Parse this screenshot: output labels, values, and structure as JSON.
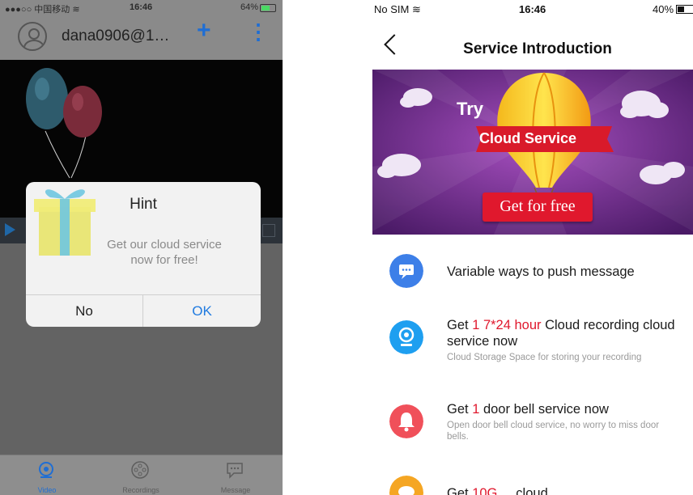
{
  "left_phone": {
    "status_bar": {
      "carrier": "●●●○○ 中国移动 ≋",
      "time": "16:46",
      "battery": "64%",
      "battery_level": 0.64
    },
    "header": {
      "account": "dana0906@1…",
      "add_icon": "plus-icon",
      "menu_icon": "more-vertical-icon"
    },
    "dialog": {
      "title": "Hint",
      "message": "Get our cloud service now for free!",
      "no_label": "No",
      "ok_label": "OK"
    },
    "tabs": [
      {
        "label": "Video",
        "icon": "camera-icon",
        "active": true
      },
      {
        "label": "Recordings",
        "icon": "film-reel-icon",
        "active": false
      },
      {
        "label": "Message",
        "icon": "chat-bubble-icon",
        "active": false
      }
    ],
    "colors": {
      "accent": "#1f6ed4"
    }
  },
  "right_phone": {
    "status_bar": {
      "carrier": "No SIM ≋",
      "time": "16:46",
      "battery": "40%",
      "battery_level": 0.4
    },
    "header": {
      "title": "Service Introduction",
      "back_icon": "chevron-left-icon"
    },
    "banner": {
      "try_text": "Try",
      "ribbon_text": "Cloud Service",
      "button_label": "Get for free"
    },
    "features": [
      {
        "icon": "chat-icon",
        "color": "#3d7fe8",
        "title_pre": "Variable ways to push message",
        "highlight": "",
        "title_post": "",
        "subtitle": ""
      },
      {
        "icon": "webcam-icon",
        "color": "#1e9ff0",
        "title_pre": "Get ",
        "highlight": "1 7*24 hour",
        "title_post": " Cloud recording cloud service now",
        "subtitle": "Cloud Storage Space for storing your recording"
      },
      {
        "icon": "bell-icon",
        "color": "#f0505a",
        "title_pre": "Get ",
        "highlight": "1",
        "title_post": " door bell service now",
        "subtitle": "Open door bell cloud service, no worry to miss door bells."
      },
      {
        "icon": "cloud-icon",
        "color": "#f5a623",
        "title_pre": "Get ",
        "highlight": "10G",
        "title_post": " ... cloud ...",
        "subtitle": ""
      }
    ],
    "colors": {
      "highlight": "#e0182d",
      "button": "#e0182d"
    }
  }
}
